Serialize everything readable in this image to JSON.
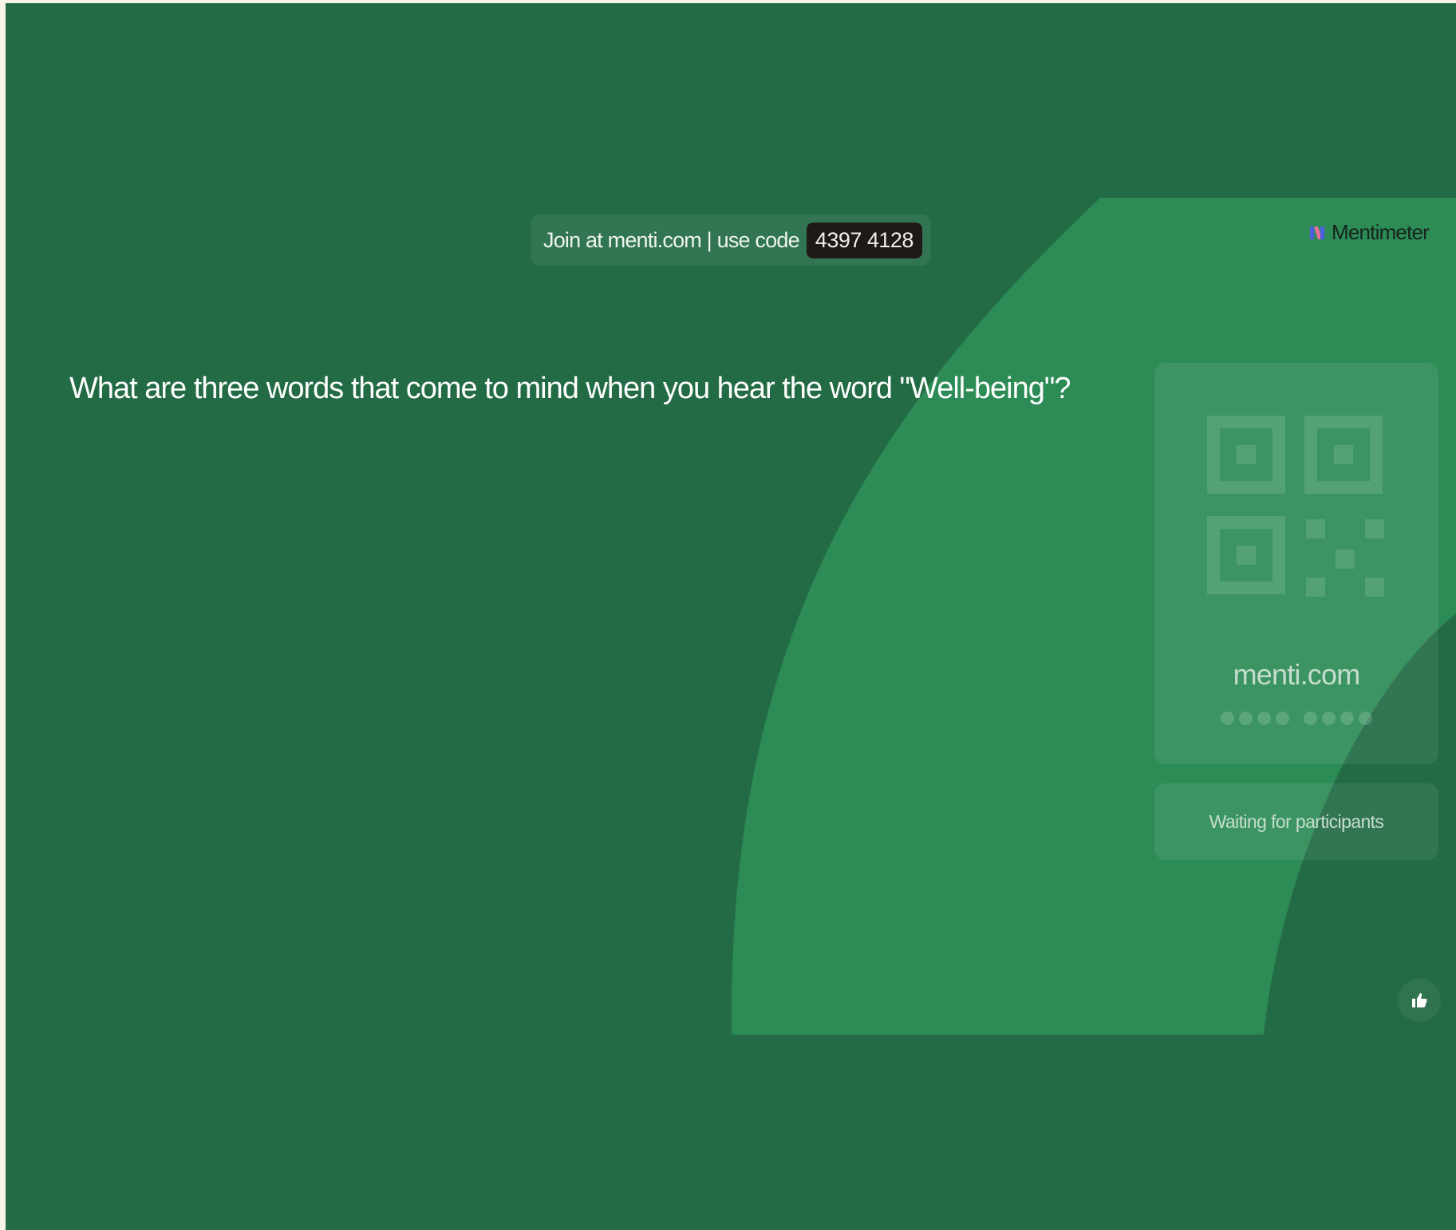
{
  "join": {
    "text": "Join at menti.com | use code",
    "code": "4397 4128"
  },
  "brand": {
    "name": "Mentimeter"
  },
  "slide": {
    "question": "What are three words that come to mind when you hear the word \"Well-being\"?"
  },
  "qr_panel": {
    "url": "menti.com",
    "code_dots_groups": [
      4,
      4
    ]
  },
  "status": {
    "text": "Waiting for participants"
  },
  "icons": {
    "brand_logo": "mentimeter-logo-icon",
    "qr": "qr-code-icon",
    "reaction": "thumbs-up-icon"
  },
  "colors": {
    "background": "#236b45",
    "accent_arc": "#2d8c56",
    "page_border": "#f7f3e6",
    "code_badge": "#1f1a17",
    "text_primary": "#ffffff",
    "text_muted": "#c6ddcd"
  }
}
